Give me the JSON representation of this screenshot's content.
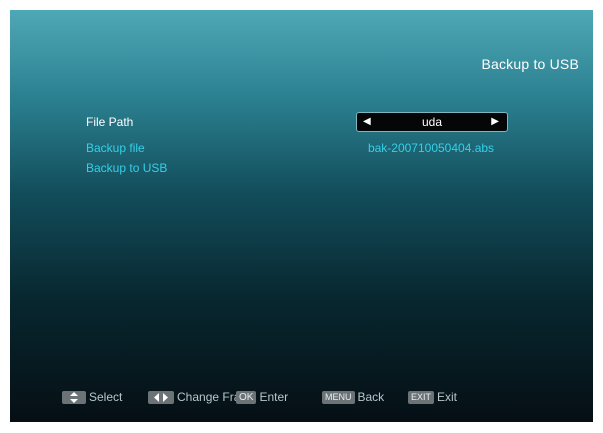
{
  "screen": {
    "title": "Backup to USB"
  },
  "menu": {
    "file_path_label": "File Path",
    "backup_file_label": "Backup file",
    "backup_to_usb_label": "Backup to USB",
    "file_path_value": "uda",
    "backup_file_value": "bak-200710050404.abs"
  },
  "footer": {
    "select_label": "Select",
    "change_label": "Change Fram",
    "ok_key": "OK",
    "enter_label": "Enter",
    "menu_key": "MENU",
    "back_label": "Back",
    "exit_key": "EXIT",
    "exit_label": "Exit"
  },
  "icons": {
    "select_key": "up-down-arrows-icon",
    "change_key": "left-right-arrows-icon",
    "selector_left": "left-triangle-icon",
    "selector_right": "right-triangle-icon"
  },
  "colors": {
    "highlight": "#34d0e8",
    "normal_text": "#ffffff",
    "footer_text": "#b8c7cc"
  }
}
